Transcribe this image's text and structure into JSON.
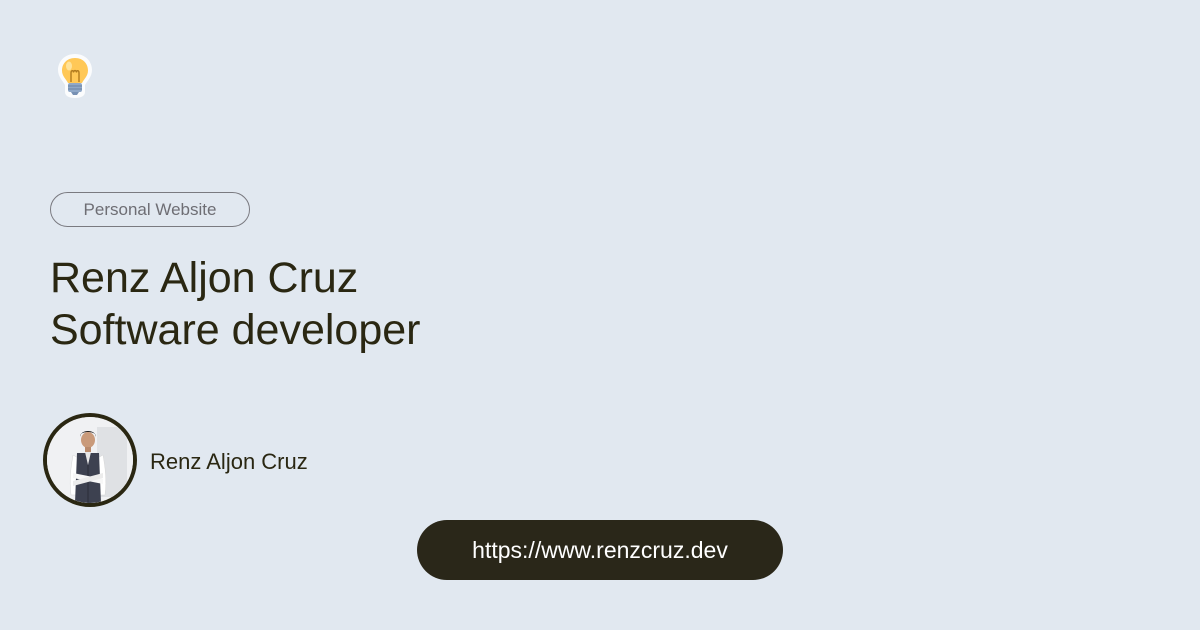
{
  "logo": {
    "icon": "lightbulb-icon",
    "color": "#ffc857"
  },
  "badge": {
    "label": "Personal Website"
  },
  "headline": {
    "line1": "Renz Aljon Cruz",
    "line2": "Software developer"
  },
  "author": {
    "name": "Renz Aljon Cruz",
    "avatar_icon": "profile-photo"
  },
  "link": {
    "url": "https://www.renzcruz.dev"
  },
  "colors": {
    "background": "#e1e8f0",
    "text": "#2a2712",
    "pill": "#2a2719"
  }
}
